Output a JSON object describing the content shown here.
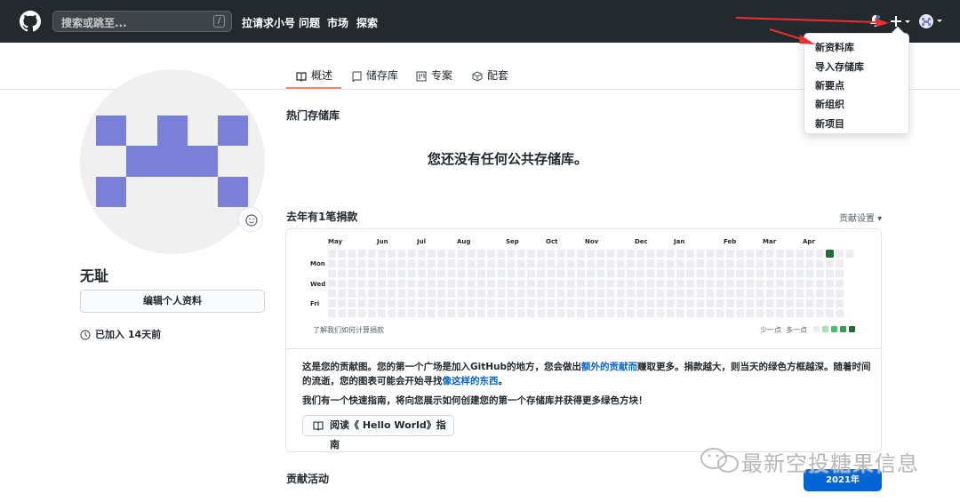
{
  "header": {
    "search_placeholder": "搜索或跳至...",
    "search_shortcut": "/",
    "nav": [
      "拉请求小号",
      "问题",
      "市场",
      "探索"
    ]
  },
  "dropdown": {
    "items": [
      "新资料库",
      "导入存储库",
      "新要点",
      "新组织",
      "新项目"
    ]
  },
  "tabs": [
    {
      "label": "概述",
      "icon": "book-icon",
      "active": true
    },
    {
      "label": "储存库",
      "icon": "repo-icon"
    },
    {
      "label": "专案",
      "icon": "project-icon"
    },
    {
      "label": "配套",
      "icon": "package-icon"
    }
  ],
  "profile": {
    "username": "无耻",
    "edit_label": "编辑个人资料",
    "joined": "已加入 14天前"
  },
  "popular": {
    "title": "热门存储库",
    "empty_message": "您还没有任何公共存储库。"
  },
  "contrib": {
    "title": "去年有1笔捐款",
    "settings": "贡献设置 ▾",
    "months": [
      "May",
      "Jun",
      "Jul",
      "Aug",
      "Sep",
      "Oct",
      "Nov",
      "Dec",
      "Jan",
      "Feb",
      "Mar",
      "Apr"
    ],
    "days": [
      "Mon",
      "Wed",
      "Fri"
    ],
    "learn": "了解我们如何计算捐款",
    "legend_less": "少一点",
    "legend_more": "多一点",
    "legend_colors": [
      "#ebedf0",
      "#9be9a8",
      "#40c463",
      "#30a14e",
      "#216e39"
    ],
    "highlight_color": "#216e39",
    "empty_color": "#ebedf0"
  },
  "info": {
    "p1_a": "这是您的贡献图。您的第一个广场是加入GitHub的地方，您会做出",
    "p1_link1": "额外的贡献而",
    "p1_b": "赚取更多。捐款越大，则当天的绿色方框越深。随着时间的流逝，您的图表可能会开始寻找",
    "p1_link2": "像这样的东西",
    "p1_c": "。",
    "p2": "我们有一个快速指南，将向您展示如何创建您的第一个存储库并获得更多绿色方块！",
    "guide_btn": "阅读《 Hello World》指南"
  },
  "activity": {
    "title": "贡献活动",
    "year": "2021年"
  },
  "watermark": "最新空投糖果信息"
}
